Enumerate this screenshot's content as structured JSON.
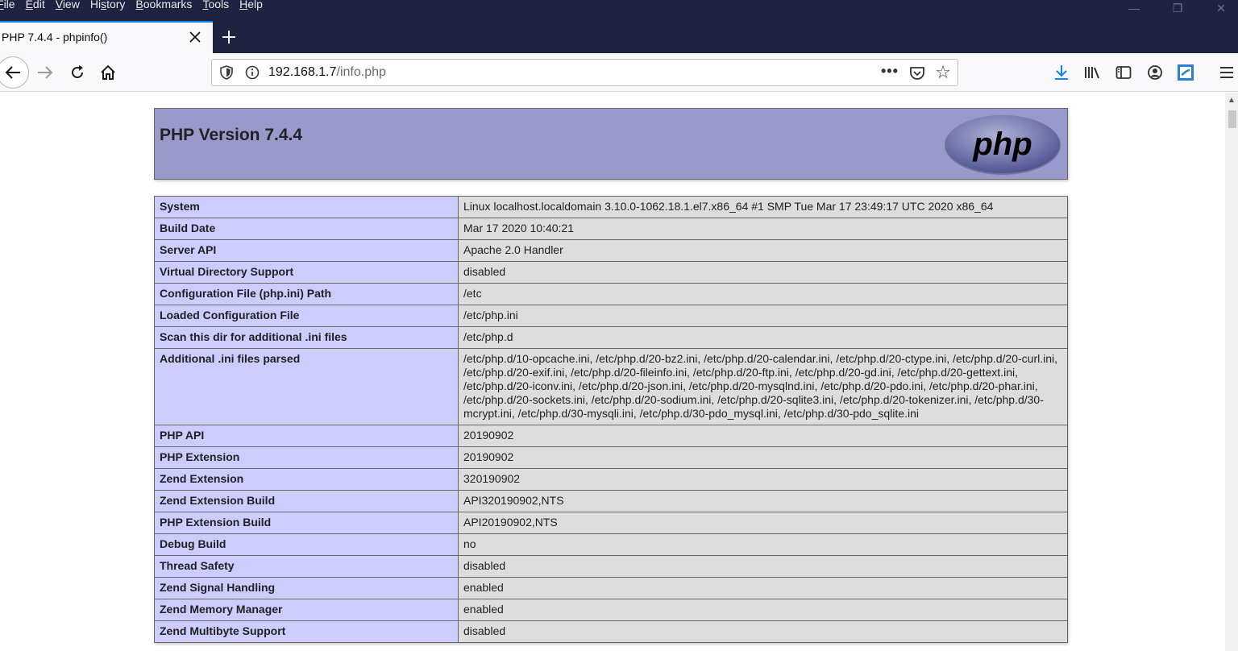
{
  "menubar": {
    "items": [
      {
        "label": "File",
        "accel": "F"
      },
      {
        "label": "Edit",
        "accel": "E"
      },
      {
        "label": "View",
        "accel": "V"
      },
      {
        "label": "History",
        "accel": "s"
      },
      {
        "label": "Bookmarks",
        "accel": "B"
      },
      {
        "label": "Tools",
        "accel": "T"
      },
      {
        "label": "Help",
        "accel": "H"
      }
    ]
  },
  "tab": {
    "title": "PHP 7.4.4 - phpinfo()"
  },
  "urlbar": {
    "host": "192.168.1.7",
    "path": "/info.php"
  },
  "page": {
    "heading": "PHP Version 7.4.4",
    "logo_text": "php",
    "rows": [
      {
        "key": "System",
        "value": "Linux localhost.localdomain 3.10.0-1062.18.1.el7.x86_64 #1 SMP Tue Mar 17 23:49:17 UTC 2020 x86_64"
      },
      {
        "key": "Build Date",
        "value": "Mar 17 2020 10:40:21"
      },
      {
        "key": "Server API",
        "value": "Apache 2.0 Handler"
      },
      {
        "key": "Virtual Directory Support",
        "value": "disabled"
      },
      {
        "key": "Configuration File (php.ini) Path",
        "value": "/etc"
      },
      {
        "key": "Loaded Configuration File",
        "value": "/etc/php.ini"
      },
      {
        "key": "Scan this dir for additional .ini files",
        "value": "/etc/php.d"
      },
      {
        "key": "Additional .ini files parsed",
        "value": "/etc/php.d/10-opcache.ini, /etc/php.d/20-bz2.ini, /etc/php.d/20-calendar.ini, /etc/php.d/20-ctype.ini, /etc/php.d/20-curl.ini, /etc/php.d/20-exif.ini, /etc/php.d/20-fileinfo.ini, /etc/php.d/20-ftp.ini, /etc/php.d/20-gd.ini, /etc/php.d/20-gettext.ini, /etc/php.d/20-iconv.ini, /etc/php.d/20-json.ini, /etc/php.d/20-mysqlnd.ini, /etc/php.d/20-pdo.ini, /etc/php.d/20-phar.ini, /etc/php.d/20-sockets.ini, /etc/php.d/20-sodium.ini, /etc/php.d/20-sqlite3.ini, /etc/php.d/20-tokenizer.ini, /etc/php.d/30-mcrypt.ini, /etc/php.d/30-mysqli.ini, /etc/php.d/30-pdo_mysql.ini, /etc/php.d/30-pdo_sqlite.ini"
      },
      {
        "key": "PHP API",
        "value": "20190902"
      },
      {
        "key": "PHP Extension",
        "value": "20190902"
      },
      {
        "key": "Zend Extension",
        "value": "320190902"
      },
      {
        "key": "Zend Extension Build",
        "value": "API320190902,NTS"
      },
      {
        "key": "PHP Extension Build",
        "value": "API20190902,NTS"
      },
      {
        "key": "Debug Build",
        "value": "no"
      },
      {
        "key": "Thread Safety",
        "value": "disabled"
      },
      {
        "key": "Zend Signal Handling",
        "value": "enabled"
      },
      {
        "key": "Zend Memory Manager",
        "value": "enabled"
      },
      {
        "key": "Zend Multibyte Support",
        "value": "disabled"
      }
    ]
  },
  "icons": {
    "back": "arrow-left-icon",
    "forward": "arrow-right-icon",
    "reload": "reload-icon",
    "home": "home-icon",
    "download": "download-icon",
    "library": "library-icon",
    "sidebar": "sidebar-icon",
    "account": "account-icon",
    "extension": "extension-icon",
    "menu": "hamburger-menu-icon"
  },
  "colors": {
    "chrome_dark": "#202340",
    "tab_active": "#f9f9fb",
    "php_header": "#9999cc",
    "key_cell": "#ccccff",
    "value_cell": "#dddddd",
    "download_accent": "#0a84ff"
  }
}
